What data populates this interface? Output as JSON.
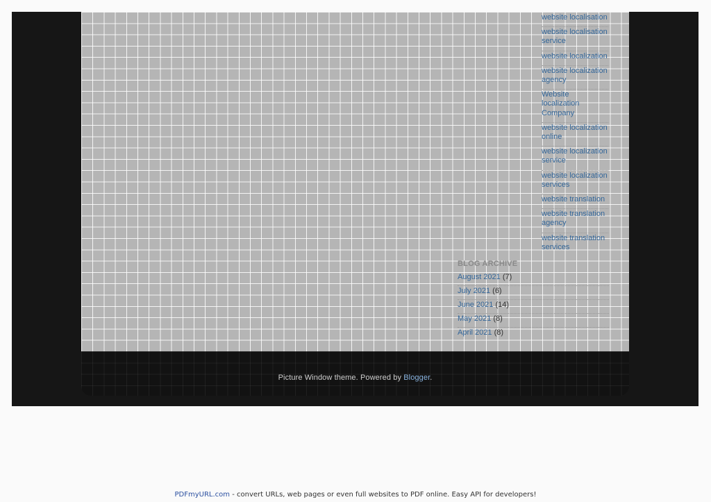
{
  "labels": [
    "website localisation",
    "website localisation service",
    "website localization",
    "website localization agency",
    "Website localization Company",
    "website localization online",
    "website localization service",
    "website localization services",
    "website translation",
    "website translation agency",
    "website translation services"
  ],
  "archive": {
    "title": "BLOG ARCHIVE",
    "items": [
      {
        "month": "August 2021",
        "count": "(7)"
      },
      {
        "month": "July 2021",
        "count": "(6)"
      },
      {
        "month": "June 2021",
        "count": "(14)"
      },
      {
        "month": "May 2021",
        "count": "(8)"
      },
      {
        "month": "April 2021",
        "count": "(8)"
      }
    ]
  },
  "footer": {
    "prefix": "Picture Window theme. Powered by ",
    "link": "Blogger",
    "suffix": "."
  },
  "banner": {
    "link": "PDFmyURL.com",
    "text": " - convert URLs, web pages or even full websites to PDF online. Easy API for developers!"
  },
  "colors": {
    "link": "#336699",
    "footer_link": "#8ab4e0",
    "grid_bg": "#b5b5b5",
    "dark_bg": "#161616"
  }
}
